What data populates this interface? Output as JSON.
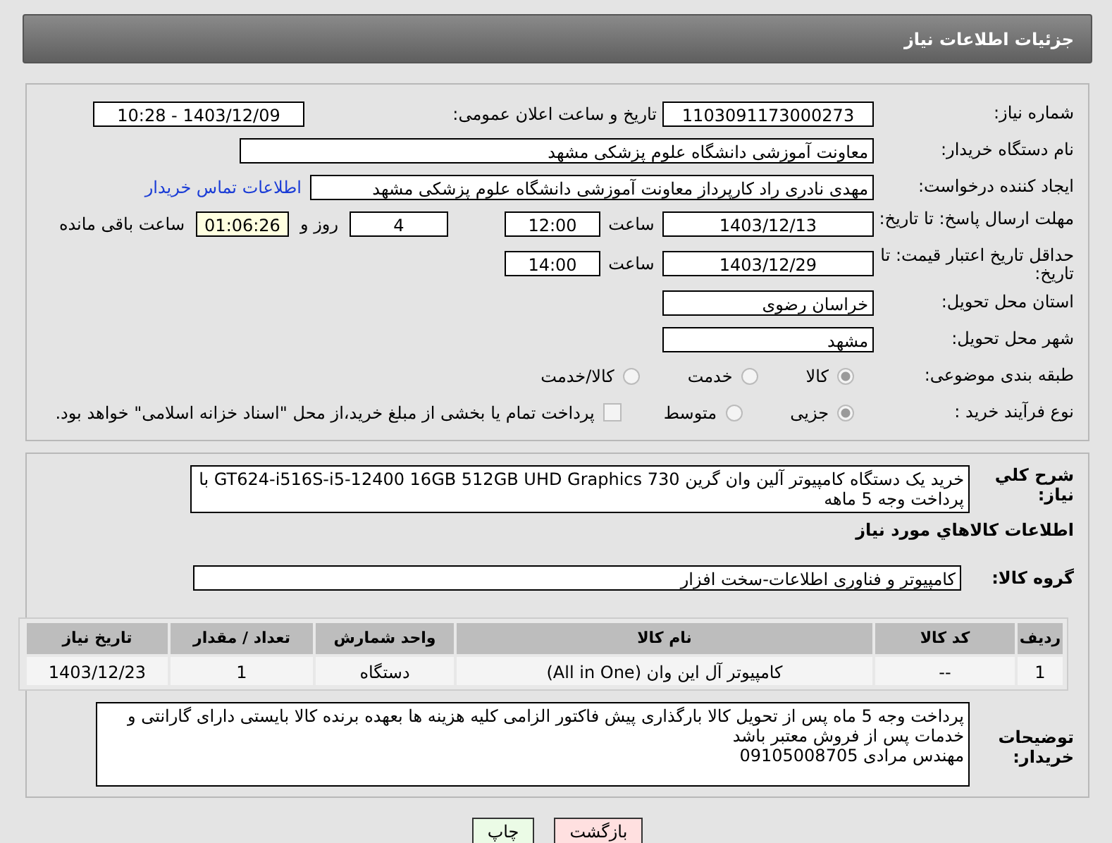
{
  "header": {
    "title": "جزئیات اطلاعات نیاز"
  },
  "need_number": {
    "label": "شماره نیاز:",
    "value": "1103091173000273"
  },
  "announce_datetime": {
    "label": "تاریخ و ساعت اعلان عمومی:",
    "value": "1403/12/09 - 10:28"
  },
  "buyer_org": {
    "label": "نام دستگاه خریدار:",
    "value": "معاونت آموزشی دانشگاه علوم پزشکی مشهد"
  },
  "requester": {
    "label": "ایجاد کننده درخواست:",
    "value": "مهدی نادری راد کارپرداز معاونت آموزشی دانشگاه علوم پزشکی مشهد",
    "link": "اطلاعات تماس خریدار"
  },
  "response_deadline": {
    "label": "مهلت ارسال پاسخ: تا تاریخ:",
    "date": "1403/12/13",
    "time_label": "ساعت",
    "time": "12:00",
    "days": "4",
    "days_label": "روز و",
    "remaining": "01:06:26",
    "remaining_label": "ساعت باقی مانده"
  },
  "price_validity": {
    "label": "حداقل تاریخ اعتبار قیمت: تا تاریخ:",
    "date": "1403/12/29",
    "time_label": "ساعت",
    "time": "14:00"
  },
  "province": {
    "label": "استان محل تحویل:",
    "value": "خراسان رضوی"
  },
  "city": {
    "label": "شهر محل تحویل:",
    "value": "مشهد"
  },
  "category": {
    "label": "طبقه بندی موضوعی:",
    "options": [
      {
        "label": "کالا",
        "selected": true
      },
      {
        "label": "خدمت",
        "selected": false
      },
      {
        "label": "کالا/خدمت",
        "selected": false
      }
    ]
  },
  "process": {
    "label": "نوع فرآیند خرید :",
    "options": [
      {
        "label": "جزیی",
        "selected": true
      },
      {
        "label": "متوسط",
        "selected": false
      }
    ],
    "checkbox": {
      "label": "پرداخت تمام یا بخشی از مبلغ خرید،از محل \"اسناد خزانه اسلامی\" خواهد بود.",
      "checked": false
    }
  },
  "description": {
    "label": "شرح کلي نياز:",
    "value": "خرید یک دستگاه کامپیوتر آلین وان گرین GT624-i516S-i5-12400  16GB 512GB UHD Graphics 730 با پرداخت وجه 5 ماهه"
  },
  "goods_section_title": "اطلاعات کالاهاي مورد نياز",
  "goods_group": {
    "label": "گروه کالا:",
    "value": "کامپیوتر و فناوری اطلاعات-سخت افزار"
  },
  "table": {
    "columns": [
      "ردیف",
      "کد کالا",
      "نام کالا",
      "واحد شمارش",
      "تعداد / مقدار",
      "تاریخ نیاز"
    ],
    "rows": [
      [
        "1",
        "--",
        "کامپیوتر آل این وان (All in One)",
        "دستگاه",
        "1",
        "1403/12/23"
      ]
    ]
  },
  "buyer_notes": {
    "label": "توضیحات خریدار:",
    "lines": [
      "پرداخت وجه 5 ماه پس از تحویل کالا بارگذاری پیش فاکتور الزامی   کلیه هزینه ها بعهده برنده کالا بایستی دارای گارانتی و خدمات پس از فروش معتبر باشد",
      "مهندس مرادی 09105008705"
    ]
  },
  "buttons": [
    {
      "label": "بازگشت",
      "kind": "back"
    },
    {
      "label": "چاپ",
      "kind": "print"
    }
  ]
}
